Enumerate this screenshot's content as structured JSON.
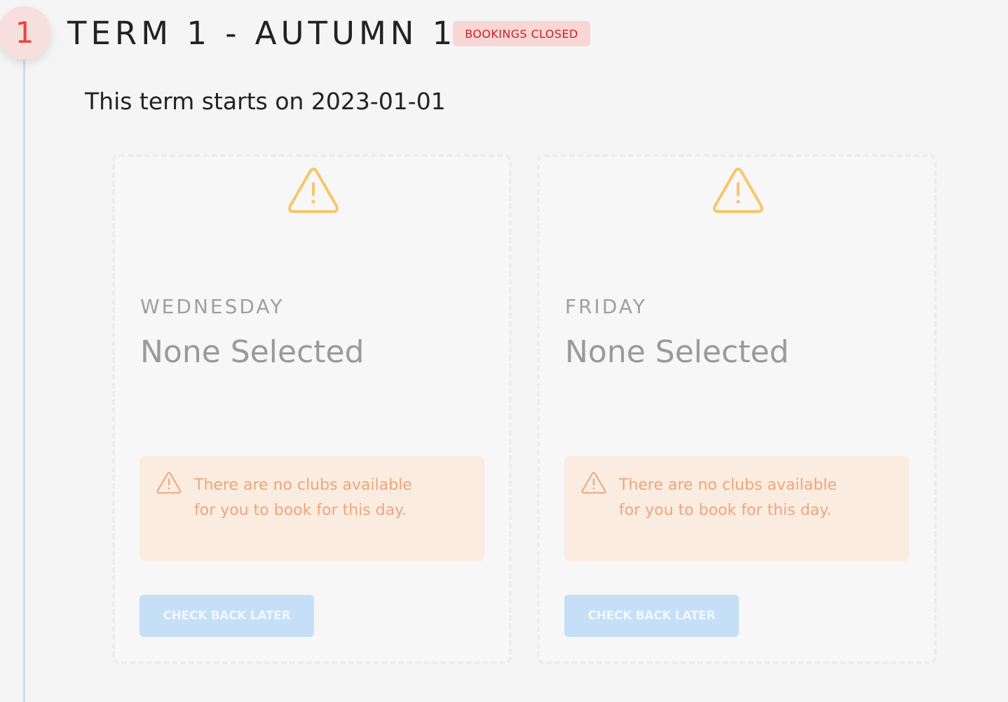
{
  "term": {
    "step_number": "1",
    "title": "TERM 1 - AUTUMN 1",
    "status_badge": "BOOKINGS CLOSED",
    "start_text": "This term starts on 2023-01-01"
  },
  "cards": [
    {
      "day": "WEDNESDAY",
      "selection": "None Selected",
      "notice": "There are no clubs available for you to book for this day.",
      "button_label": "CHECK BACK LATER"
    },
    {
      "day": "FRIDAY",
      "selection": "None Selected",
      "notice": "There are no clubs available for you to book for this day.",
      "button_label": "CHECK BACK LATER"
    }
  ],
  "colors": {
    "step_accent": "#e8463e",
    "badge_background": "#f7d6d4",
    "badge_text": "#c3242a",
    "warning_icon": "#f8c56b",
    "notice_background": "#faece0",
    "notice_text": "#f0a57a",
    "button_disabled": "#c4dff6"
  },
  "icons": {
    "card_warning": "warning-triangle-icon",
    "notice_warning": "warning-triangle-icon"
  }
}
